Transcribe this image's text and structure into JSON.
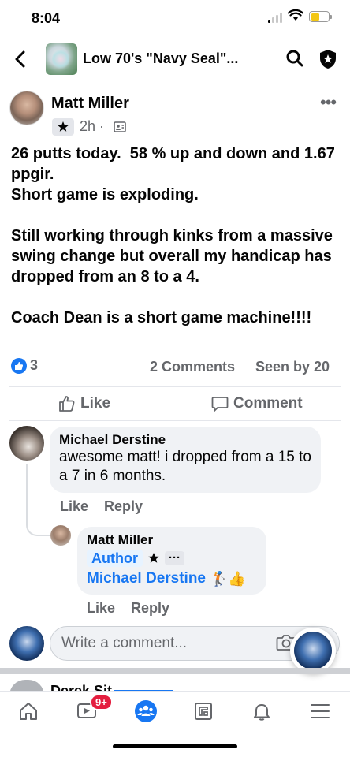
{
  "status": {
    "time": "8:04"
  },
  "header": {
    "title": "Low 70's \"Navy Seal\"..."
  },
  "post": {
    "author": "Matt Miller",
    "time": "2h ·",
    "body": [
      "26 putts today.  58 % up and down and 1.67 ppgir.",
      "Short game is exploding.",
      "",
      "Still working through kinks from a massive swing change but overall my handicap has dropped from an 8 to a 4.",
      "",
      "Coach Dean is a short game machine!!!!"
    ],
    "reaction_count": "3",
    "comments_count": "2 Comments",
    "seen_by": "Seen by 20",
    "like_label": "Like",
    "comment_label": "Comment"
  },
  "comments": [
    {
      "author": "Michael Derstine",
      "text": "awesome matt!  i dropped from a 15 to a 7 in 6 months.",
      "like": "Like",
      "reply": "Reply"
    },
    {
      "author": "Matt Miller",
      "tag": "Author",
      "more": "···",
      "mention": "Michael Derstine",
      "emoji": "🏌👍",
      "like": "Like",
      "reply": "Reply"
    }
  ],
  "composer": {
    "placeholder": "Write a comment..."
  },
  "next_post": {
    "author": "Derek Sit"
  },
  "tabbar": {
    "video_badge": "9+"
  },
  "colors": {
    "accent": "#1877f2",
    "badge": "#e41e3f",
    "muted": "#65676b"
  }
}
